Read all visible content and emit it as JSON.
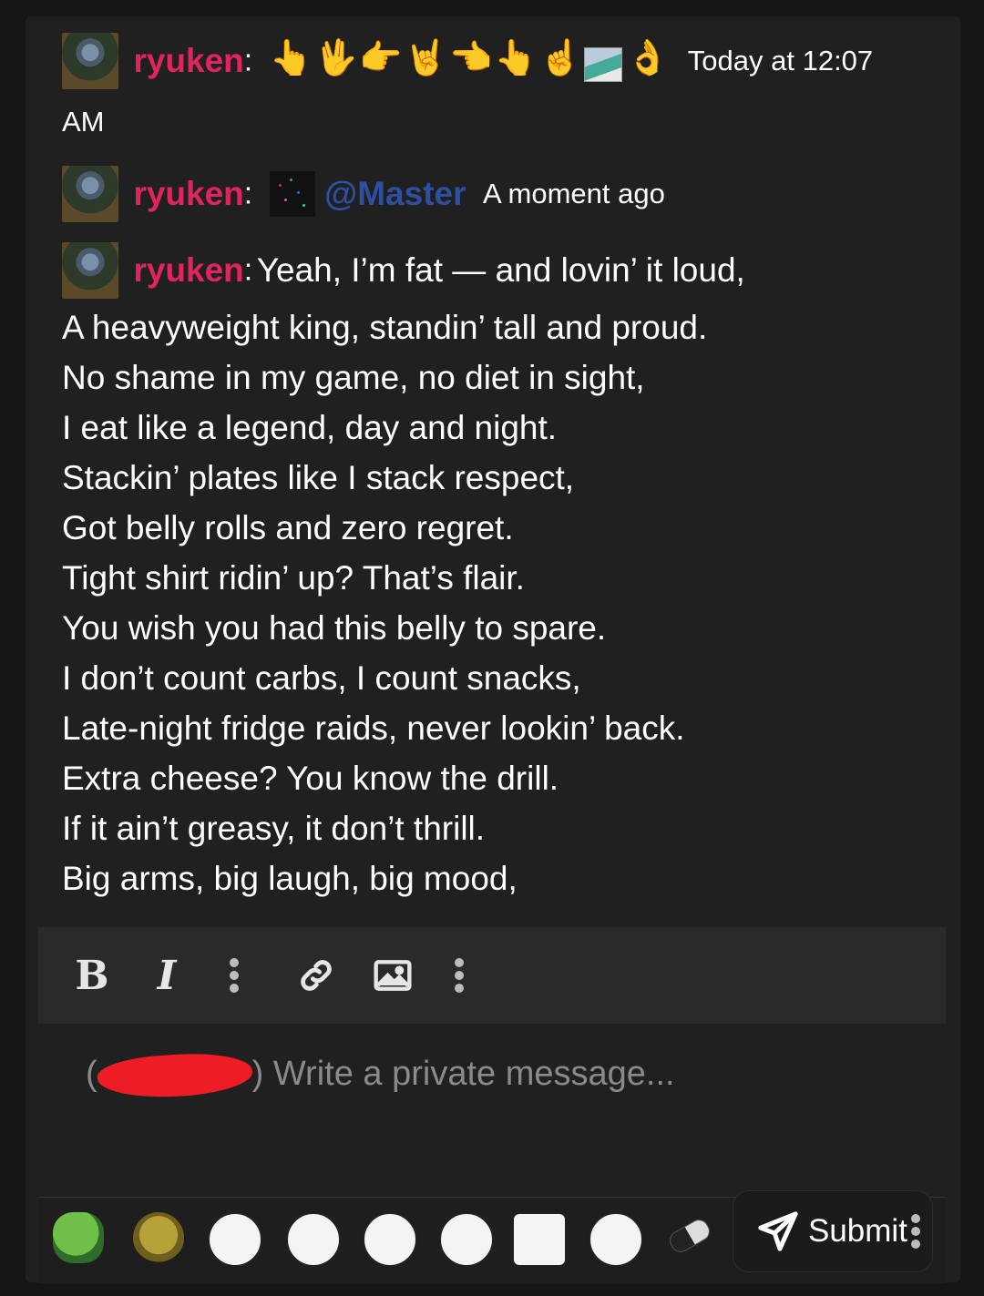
{
  "messages": [
    {
      "username": "ryuken",
      "emojis": [
        "👆",
        "🖖",
        "👉",
        "🤘",
        "👈",
        "👆",
        "☝",
        "broken-image",
        "👌"
      ],
      "timestamp": "Today at 12:07 AM"
    },
    {
      "username": "ryuken",
      "mention": "@Master",
      "timestamp": "A moment ago"
    },
    {
      "username": "ryuken",
      "first_line": "Yeah, I’m fat — and lovin’ it loud,",
      "lines": [
        "A heavyweight king, standin’ tall and proud.",
        "No shame in my game, no diet in sight,",
        "I eat like a legend, day and night.",
        "Stackin’ plates like I stack respect,",
        "Got belly rolls and zero regret.",
        "Tight shirt ridin’ up? That’s flair.",
        "You wish you had this belly to spare.",
        "I don’t count carbs, I count snacks,",
        "Late-night fridge raids, never lookin’ back.",
        "Extra cheese? You know the drill.",
        "If it ain’t greasy, it don’t thrill.",
        "Big arms, big laugh, big mood,"
      ]
    }
  ],
  "colon": ":",
  "toolbar": {
    "bold": "B",
    "italic": "I",
    "icons": [
      "bold-icon",
      "italic-icon",
      "more-vertical-icon",
      "link-icon",
      "image-icon",
      "more-vertical-icon"
    ]
  },
  "compose": {
    "open_paren": "(",
    "close_paren": ")",
    "placeholder": "Write a private message..."
  },
  "smilies": [
    "pepe-laugh",
    "shrek",
    "crying-wojak",
    "crying-wojak-2",
    "wojak-smile",
    "glasses-wojak",
    "wojak-reaching",
    "wojak-worried",
    "pill"
  ],
  "submit": {
    "label": "Submit"
  },
  "colors": {
    "username": "#e0245e",
    "mention": "#2e4fa0",
    "background": "#202020"
  }
}
